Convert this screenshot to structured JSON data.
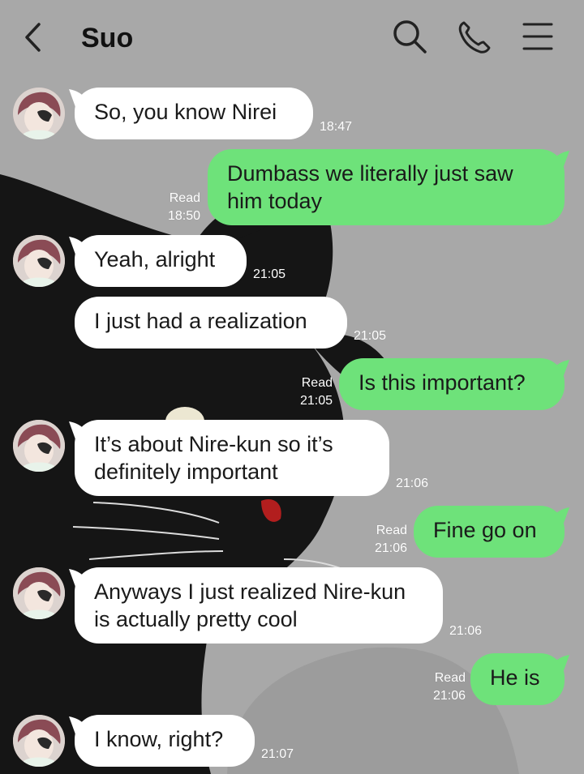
{
  "header": {
    "title": "Suo",
    "icons": [
      "chevron-left-icon",
      "search-icon",
      "phone-icon",
      "menu-icon"
    ]
  },
  "colors": {
    "incoming_bubble": "#ffffff",
    "outgoing_bubble": "#6ee27a",
    "background": "#a7a7a7"
  },
  "messages": [
    {
      "sender": "Suo",
      "text": "So, you know Nirei",
      "time": "18:47"
    },
    {
      "sender": "me",
      "text": "Dumbass we literally just saw him today",
      "status": "Read",
      "time": "18:50"
    },
    {
      "sender": "Suo",
      "text": "Yeah, alright",
      "time": "21:05"
    },
    {
      "sender": "Suo",
      "text": "I just had a realization",
      "time": "21:05"
    },
    {
      "sender": "me",
      "text": "Is this important?",
      "status": "Read",
      "time": "21:05"
    },
    {
      "sender": "Suo",
      "text": "It’s about Nire-kun so it’s definitely important",
      "time": "21:06"
    },
    {
      "sender": "me",
      "text": "Fine go on",
      "status": "Read",
      "time": "21:06"
    },
    {
      "sender": "Suo",
      "text": "Anyways I just realized Nire-kun is actually pretty cool",
      "time": "21:06"
    },
    {
      "sender": "me",
      "text": "He is",
      "status": "Read",
      "time": "21:06"
    },
    {
      "sender": "Suo",
      "text": "I know, right?",
      "time": "21:07"
    }
  ]
}
